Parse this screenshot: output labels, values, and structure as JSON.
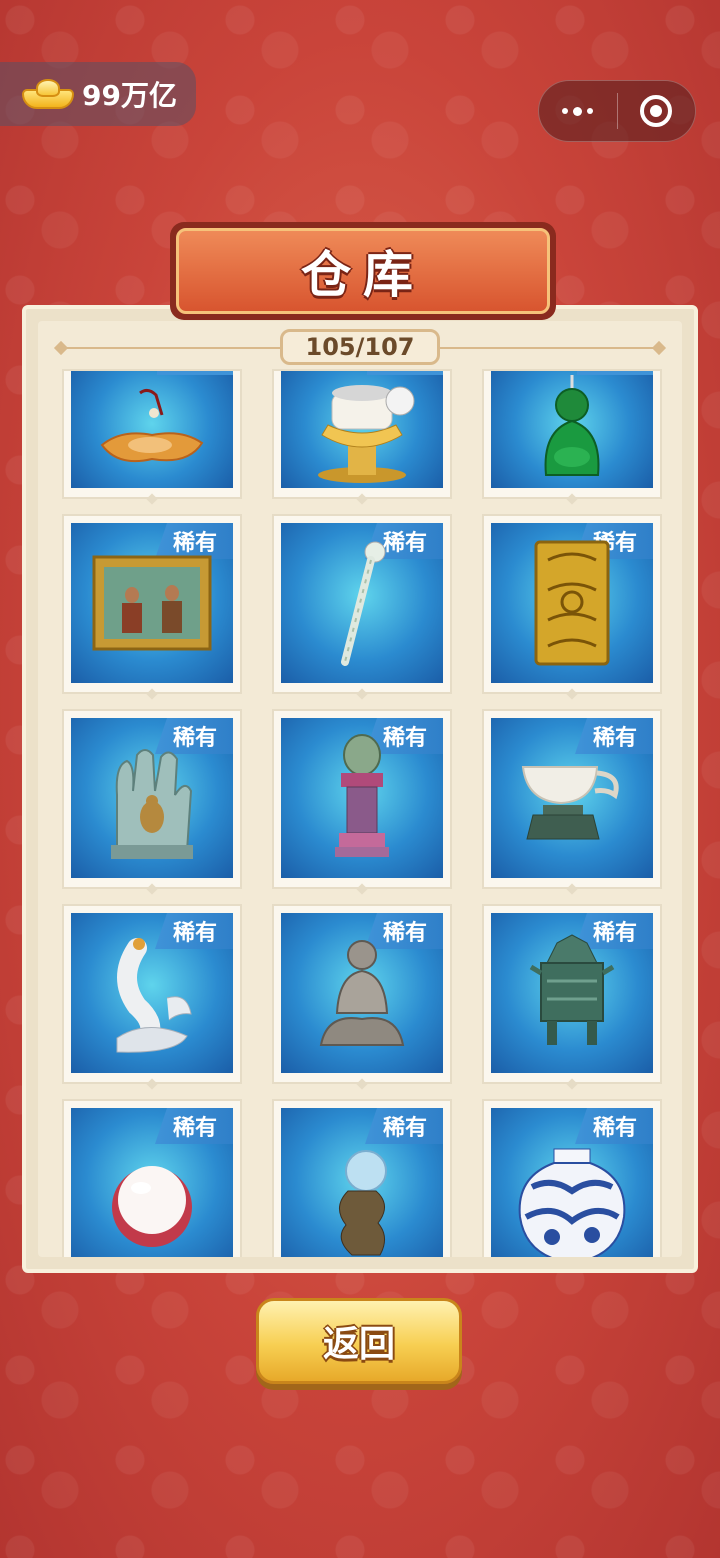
{
  "header": {
    "coins": "99万亿",
    "coin_icon": "gold-ingot-icon",
    "capsule": {
      "more_icon": "more-dots-icon",
      "close_icon": "target-close-icon"
    }
  },
  "title": "仓库",
  "count": "105/107",
  "items": [
    {
      "name": "jade-pendant-orange",
      "tag": ""
    },
    {
      "name": "silver-tea-vessel",
      "tag": ""
    },
    {
      "name": "green-jade-buddha",
      "tag": ""
    },
    {
      "name": "framed-painting",
      "tag": "稀有"
    },
    {
      "name": "jade-ruyi-scepter",
      "tag": "稀有"
    },
    {
      "name": "gold-plaque",
      "tag": "稀有"
    },
    {
      "name": "buddha-hand",
      "tag": "稀有"
    },
    {
      "name": "ornate-stand-vessel",
      "tag": "稀有"
    },
    {
      "name": "white-jade-cup",
      "tag": "稀有"
    },
    {
      "name": "white-fish-carving",
      "tag": "稀有"
    },
    {
      "name": "stone-buddha-statue",
      "tag": "稀有"
    },
    {
      "name": "bronze-ritual-vessel",
      "tag": "稀有"
    },
    {
      "name": "large-pearl",
      "tag": "稀有"
    },
    {
      "name": "crystal-ball-stand",
      "tag": "稀有"
    },
    {
      "name": "blue-white-porcelain-jar",
      "tag": "稀有"
    }
  ],
  "back_button": "返回"
}
